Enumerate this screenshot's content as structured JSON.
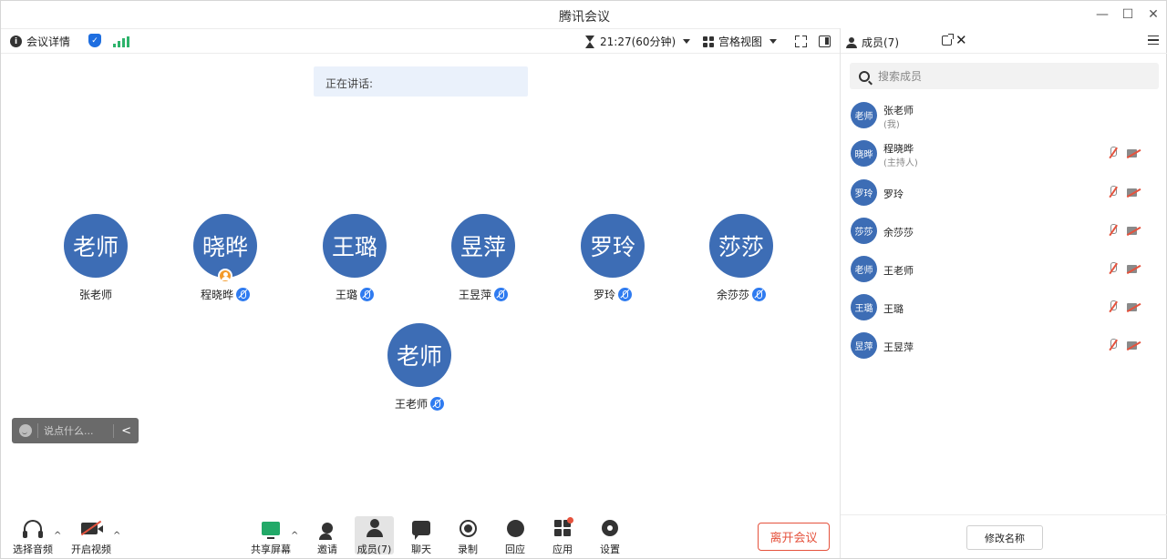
{
  "window": {
    "title": "腾讯会议",
    "controls": {
      "minimize": "—",
      "maximize": "☐",
      "close": "✕"
    }
  },
  "infobar": {
    "meeting_details": "会议详情",
    "timer": "21:27(60分钟)",
    "view_mode": "宫格视图"
  },
  "speaking": {
    "label": "正在讲话:"
  },
  "tiles": [
    {
      "initials": "老师",
      "name": "张老师",
      "mic": false,
      "host": false
    },
    {
      "initials": "晓晔",
      "name": "程晓晔",
      "mic": true,
      "host": true
    },
    {
      "initials": "王璐",
      "name": "王璐",
      "mic": true,
      "host": false
    },
    {
      "initials": "昱萍",
      "name": "王昱萍",
      "mic": true,
      "host": false
    },
    {
      "initials": "罗玲",
      "name": "罗玲",
      "mic": true,
      "host": false
    },
    {
      "initials": "莎莎",
      "name": "余莎莎",
      "mic": true,
      "host": false
    },
    {
      "initials": "老师",
      "name": "王老师",
      "mic": true,
      "host": false
    }
  ],
  "chat": {
    "placeholder": "说点什么...",
    "collapse": "<"
  },
  "bottom": {
    "audio": "选择音频",
    "video": "开启视频",
    "share": "共享屏幕",
    "invite": "邀请",
    "members": "成员(7)",
    "chat": "聊天",
    "record": "录制",
    "react": "回应",
    "apps": "应用",
    "settings": "设置",
    "leave": "离开会议",
    "caret": "^"
  },
  "panel": {
    "title": "成员(7)",
    "close": "✕",
    "search_placeholder": "搜索成员",
    "members": [
      {
        "initials": "老师",
        "name": "张老师",
        "sub": "(我)"
      },
      {
        "initials": "晓晔",
        "name": "程晓晔",
        "sub": "(主持人)"
      },
      {
        "initials": "罗玲",
        "name": "罗玲",
        "sub": ""
      },
      {
        "initials": "莎莎",
        "name": "余莎莎",
        "sub": ""
      },
      {
        "initials": "老师",
        "name": "王老师",
        "sub": ""
      },
      {
        "initials": "王璐",
        "name": "王璐",
        "sub": ""
      },
      {
        "initials": "昱萍",
        "name": "王昱萍",
        "sub": ""
      }
    ],
    "rename": "修改名称"
  },
  "colors": {
    "avatar": "#3d6db5",
    "mic_badge": "#2f7bf0",
    "host_badge": "#f39a2b",
    "leave": "#e5523d",
    "share": "#22a968",
    "signal": "#2db36b"
  }
}
